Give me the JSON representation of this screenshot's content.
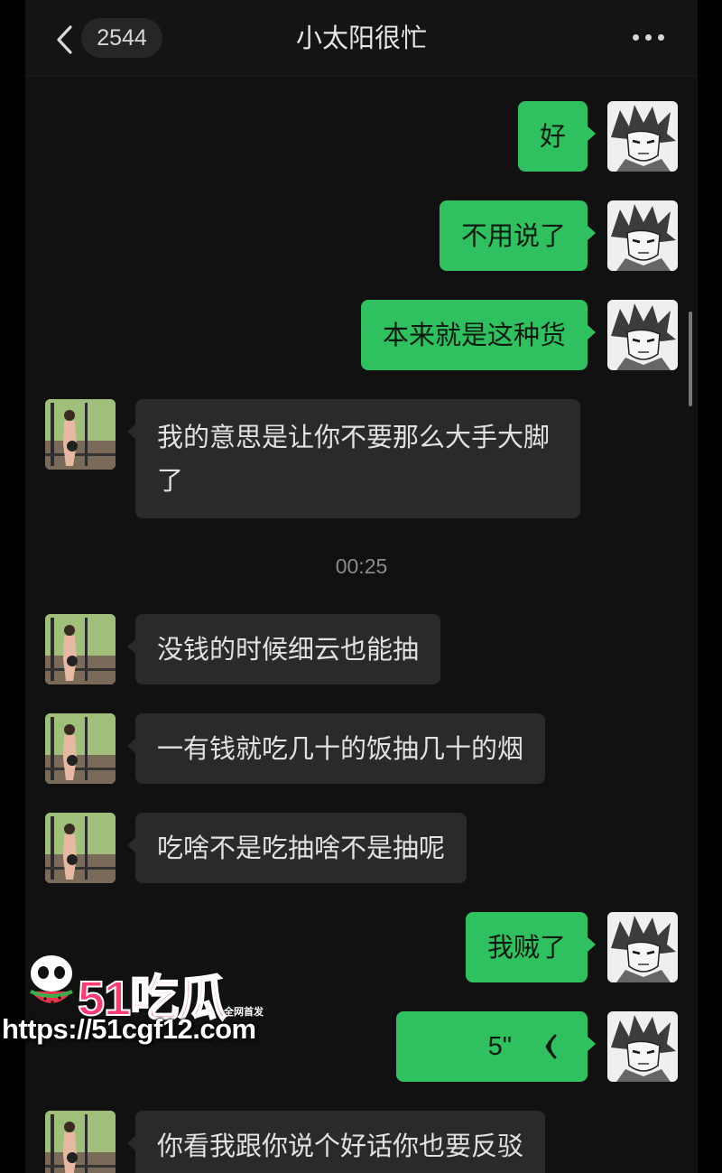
{
  "header": {
    "unread_count": "2544",
    "title": "小太阳很忙"
  },
  "messages": [
    {
      "side": "out",
      "text": "好"
    },
    {
      "side": "out",
      "text": "不用说了"
    },
    {
      "side": "out",
      "text": "本来就是这种货"
    },
    {
      "side": "in",
      "text": "我的意思是让你不要那么大手大脚了"
    },
    {
      "type": "time",
      "text": "00:25"
    },
    {
      "side": "in",
      "text": "没钱的时候细云也能抽"
    },
    {
      "side": "in",
      "text": "一有钱就吃几十的饭抽几十的烟"
    },
    {
      "side": "in",
      "text": "吃啥不是吃抽啥不是抽呢"
    },
    {
      "side": "out",
      "text": "我贼了"
    },
    {
      "side": "out",
      "type": "voice",
      "duration": "5\""
    },
    {
      "side": "in",
      "text": "你看我跟你说个好话你也要反驳"
    }
  ],
  "watermark": {
    "logo": "51吃瓜",
    "tag": "全网首发",
    "url": "https://51cgf12.com"
  },
  "colors": {
    "outgoing_bubble": "#2fc15f",
    "incoming_bubble": "#2a2a2a",
    "background": "#111111",
    "watermark_accent": "#ff3a73"
  }
}
